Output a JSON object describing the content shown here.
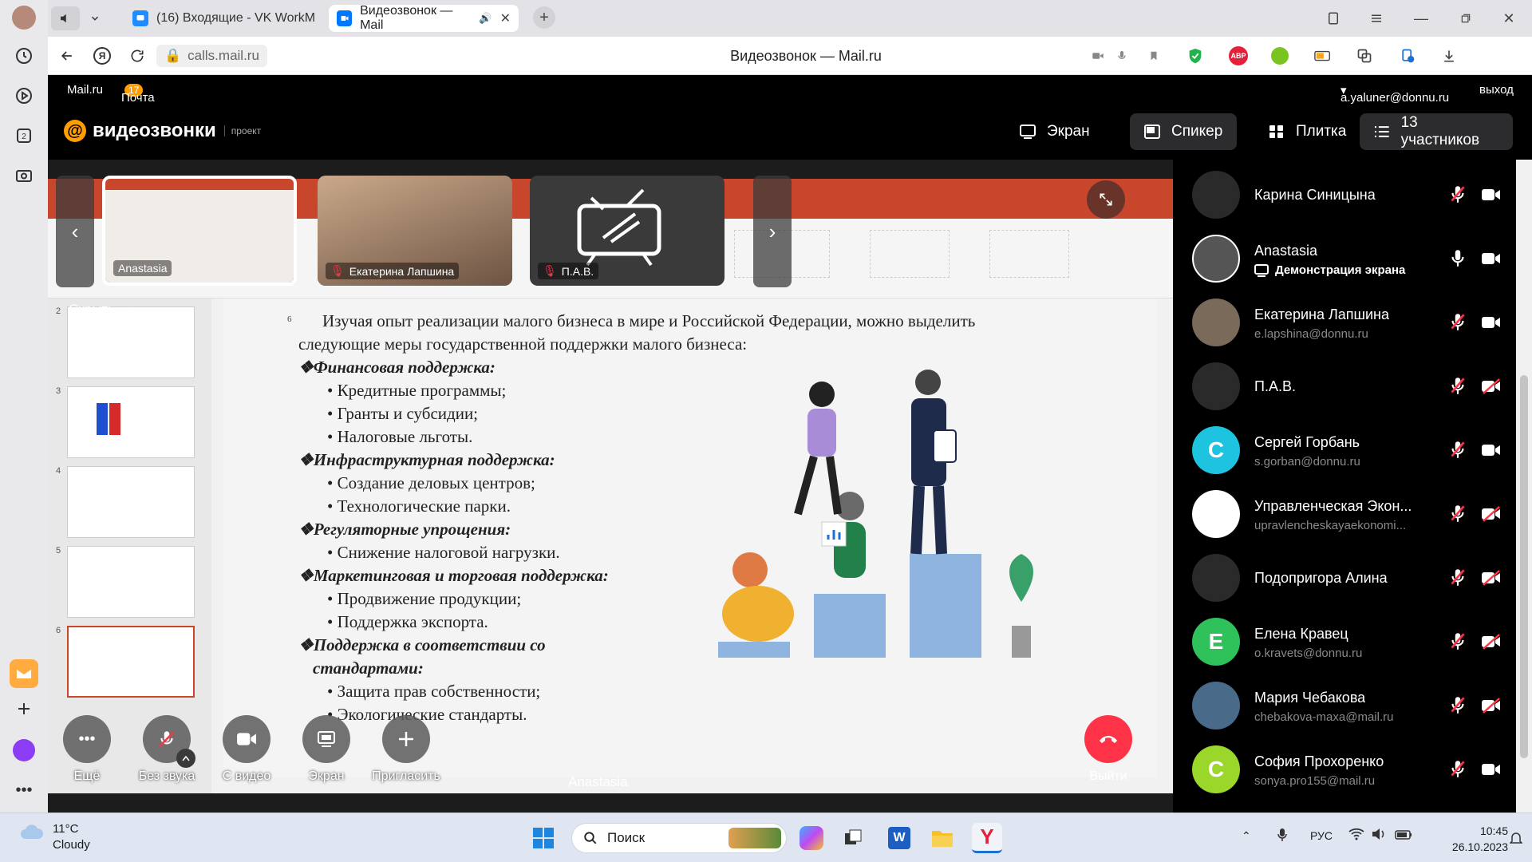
{
  "browser": {
    "tabs": [
      {
        "label": "(16) Входящие - VK WorkM"
      },
      {
        "label": "Видеозвонок — Mail"
      }
    ],
    "url": "calls.mail.ru",
    "page_title": "Видеозвонок — Mail.ru"
  },
  "mail_strip": {
    "home": "Mail.ru",
    "mail": "Почта",
    "mail_count": "17",
    "account": "a.yaluner@donnu.ru",
    "logout": "выход"
  },
  "header": {
    "logo": "видеозвонки",
    "project": "проект",
    "views": {
      "screen": "Экран",
      "speaker": "Спикер",
      "tile": "Плитка",
      "participants": "13 участников"
    }
  },
  "strip": {
    "cards": [
      {
        "name": "Anastasia"
      },
      {
        "name": "Екатерина Лапшина"
      },
      {
        "name": "П.А.В."
      }
    ],
    "hide": "Скрыть"
  },
  "slide": {
    "number": "6",
    "lines": [
      {
        "t": "Изучая опыт реализации малого бизнеса в мире и Российской Федерации, можно выделить следующие меры государственной поддержки малого бизнеса:",
        "k": "p"
      },
      {
        "t": "❖Финансовая поддержка:",
        "k": "hd"
      },
      {
        "t": "• Кредитные программы;",
        "k": "it"
      },
      {
        "t": "• Гранты и субсидии;",
        "k": "it"
      },
      {
        "t": "• Налоговые льготы.",
        "k": "it"
      },
      {
        "t": "❖Инфраструктурная поддержка:",
        "k": "hd"
      },
      {
        "t": "• Создание деловых центров;",
        "k": "it"
      },
      {
        "t": "• Технологические парки.",
        "k": "it"
      },
      {
        "t": "❖Регуляторные упрощения:",
        "k": "hd"
      },
      {
        "t": "• Снижение налоговой нагрузки.",
        "k": "it"
      },
      {
        "t": "❖Маркетинговая и торговая поддержка:",
        "k": "hd"
      },
      {
        "t": "• Продвижение продукции;",
        "k": "it"
      },
      {
        "t": "• Поддержка экспорта.",
        "k": "it"
      },
      {
        "t": "❖Поддержка в соответствии со",
        "k": "hd"
      },
      {
        "t": "стандартами:",
        "k": "hd2"
      },
      {
        "t": "• Защита прав собственности;",
        "k": "it"
      },
      {
        "t": "• Экологические стандарты.",
        "k": "it"
      }
    ]
  },
  "controls": {
    "more": "Ещё",
    "mute": "Без звука",
    "video": "С видео",
    "screen": "Экран",
    "invite": "Пригласить",
    "exit": "Выйти",
    "speaker": "Anastasia"
  },
  "participants": [
    {
      "name": "Карина Синицына",
      "email": "",
      "sub": "",
      "avatar_color": "#2a2a2a",
      "avatar_letter": "",
      "mic": "off",
      "cam": "on"
    },
    {
      "name": "Anastasia",
      "email": "",
      "sub": "Демонстрация экрана",
      "avatar_color": "#555555",
      "avatar_letter": "",
      "mic": "on",
      "cam": "on"
    },
    {
      "name": "Екатерина Лапшина",
      "email": "e.lapshina@donnu.ru",
      "sub": "",
      "avatar_color": "#7a6a5a",
      "avatar_letter": "",
      "mic": "off",
      "cam": "on"
    },
    {
      "name": "П.А.В.",
      "email": "",
      "sub": "",
      "avatar_color": "#2a2a2a",
      "avatar_letter": "",
      "mic": "off",
      "cam": "off"
    },
    {
      "name": "Сергей Горбань",
      "email": "s.gorban@donnu.ru",
      "sub": "",
      "avatar_color": "#1ec3e0",
      "avatar_letter": "С",
      "mic": "off",
      "cam": "on"
    },
    {
      "name": "Управленческая Экон...",
      "email": "upravlencheskayaekonomi...",
      "sub": "",
      "avatar_color": "#ffffff",
      "avatar_letter": "",
      "mic": "off",
      "cam": "off"
    },
    {
      "name": "Подопригора Алина",
      "email": "",
      "sub": "",
      "avatar_color": "#2a2a2a",
      "avatar_letter": "",
      "mic": "off",
      "cam": "off"
    },
    {
      "name": "Елена Кравец",
      "email": "o.kravets@donnu.ru",
      "sub": "",
      "avatar_color": "#2fc15a",
      "avatar_letter": "Е",
      "mic": "off",
      "cam": "off"
    },
    {
      "name": "Мария Чебакова",
      "email": "chebakova-maxa@mail.ru",
      "sub": "",
      "avatar_color": "#4a6a8a",
      "avatar_letter": "",
      "mic": "off",
      "cam": "off"
    },
    {
      "name": "София Прохоренко",
      "email": "sonya.pro155@mail.ru",
      "sub": "",
      "avatar_color": "#9bd62b",
      "avatar_letter": "С",
      "mic": "off",
      "cam": "on"
    }
  ],
  "taskbar": {
    "temp": "11°C",
    "weather": "Cloudy",
    "search": "Поиск",
    "lang": "РУС",
    "time": "10:45",
    "date": "26.10.2023"
  },
  "colors": {
    "accent": "#ff9e00",
    "exit": "#ff3347",
    "mic_off": "#ff3347"
  }
}
